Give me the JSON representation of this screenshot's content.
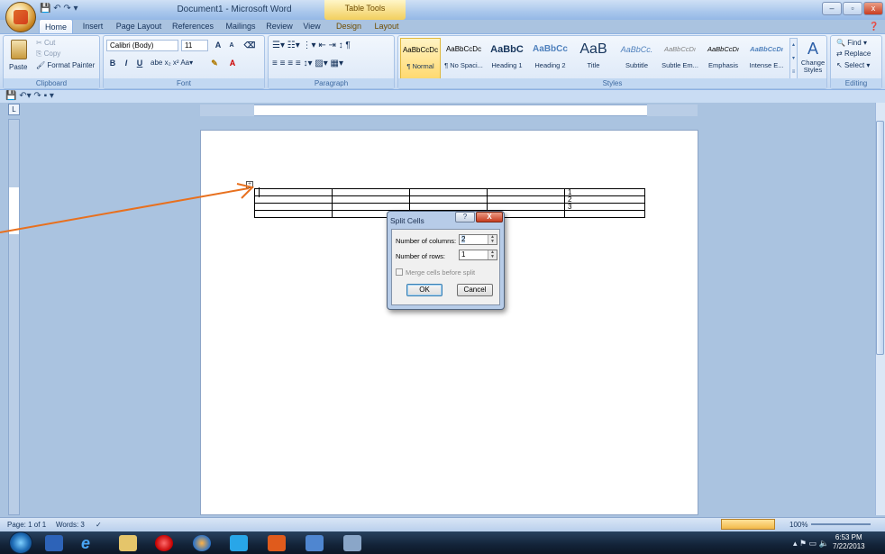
{
  "window": {
    "title": "Document1 - Microsoft Word",
    "context_tab_group": "Table Tools"
  },
  "tabs": [
    "Home",
    "Insert",
    "Page Layout",
    "References",
    "Mailings",
    "Review",
    "View",
    "Design",
    "Layout"
  ],
  "clipboard": {
    "paste": "Paste",
    "cut": "Cut",
    "copy": "Copy",
    "format_painter": "Format Painter",
    "label": "Clipboard"
  },
  "font": {
    "name": "Calibri (Body)",
    "size": "11",
    "label": "Font",
    "bold": "B",
    "italic": "I",
    "underline": "U"
  },
  "paragraph": {
    "label": "Paragraph"
  },
  "styles": {
    "label": "Styles",
    "items": [
      {
        "preview": "AaBbCcDc",
        "name": "¶ Normal"
      },
      {
        "preview": "AaBbCcDc",
        "name": "¶ No Spaci..."
      },
      {
        "preview": "AaBbC",
        "name": "Heading 1"
      },
      {
        "preview": "AaBbCc",
        "name": "Heading 2"
      },
      {
        "preview": "AaB",
        "name": "Title"
      },
      {
        "preview": "AaBbCc.",
        "name": "Subtitle"
      },
      {
        "preview": "AaBbCcDı",
        "name": "Subtle Em..."
      },
      {
        "preview": "AaBbCcDı",
        "name": "Emphasis"
      },
      {
        "preview": "AaBbCcDı",
        "name": "Intense E..."
      }
    ],
    "change_styles": "Change Styles"
  },
  "editing": {
    "find": "Find",
    "replace": "Replace",
    "select": "Select",
    "label": "Editing"
  },
  "document_table": {
    "rows": [
      [
        "",
        "",
        "",
        "",
        "1"
      ],
      [
        "",
        "",
        "",
        "",
        "2"
      ],
      [
        "",
        "",
        "",
        "",
        "3"
      ],
      [
        "",
        "",
        "",
        "",
        ""
      ]
    ]
  },
  "dialog": {
    "title": "Split Cells",
    "help": "?",
    "close": "X",
    "columns_label": "Number of columns:",
    "columns_value": "2",
    "rows_label": "Number of rows:",
    "rows_value": "1",
    "merge_label": "Merge cells before split",
    "ok": "OK",
    "cancel": "Cancel"
  },
  "status": {
    "page": "Page: 1 of 1",
    "words": "Words: 3",
    "zoom": "100%"
  },
  "tray": {
    "time": "6:53 PM",
    "date": "7/22/2013"
  },
  "colors": {
    "arrow": "#e8701e",
    "ribbon": "#d3e2f5",
    "close": "#c83c20"
  }
}
